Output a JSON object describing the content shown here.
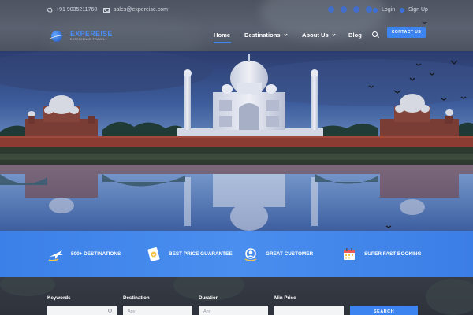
{
  "topbar": {
    "phone": "+91 9035211760",
    "email": "sales@expereise.com",
    "social_icons": [
      "facebook-icon",
      "twitter-icon",
      "instagram-icon",
      "linkedin-icon"
    ],
    "login": "Login",
    "signup": "Sign Up"
  },
  "brand": {
    "name": "EXPEREISE",
    "tagline": "EXPERIENCE TRAVEL"
  },
  "nav": {
    "items": [
      {
        "label": "Home",
        "active": true
      },
      {
        "label": "Destinations",
        "dropdown": true
      },
      {
        "label": "About Us",
        "dropdown": true
      },
      {
        "label": "Blog"
      }
    ],
    "contact_button": "CONTACT US"
  },
  "features": [
    {
      "icon": "plane-icon",
      "label": "500+ DESTINATIONS"
    },
    {
      "icon": "price-tag-icon",
      "label": "BEST PRICE GUARANTEE"
    },
    {
      "icon": "customer-icon",
      "label": "GREAT CUSTOMER"
    },
    {
      "icon": "calendar-icon",
      "label": "SUPER FAST BOOKING"
    }
  ],
  "search": {
    "keywords_label": "Keywords",
    "destination_label": "Destination",
    "destination_value": "Any",
    "duration_label": "Duration",
    "duration_value": "Any",
    "min_price_label": "Min Price",
    "button": "SEARCH"
  },
  "colors": {
    "accent": "#3c84ef",
    "features_bg": "#4a8eef",
    "header_bg": "#555b68",
    "search_bg": "#323741"
  }
}
